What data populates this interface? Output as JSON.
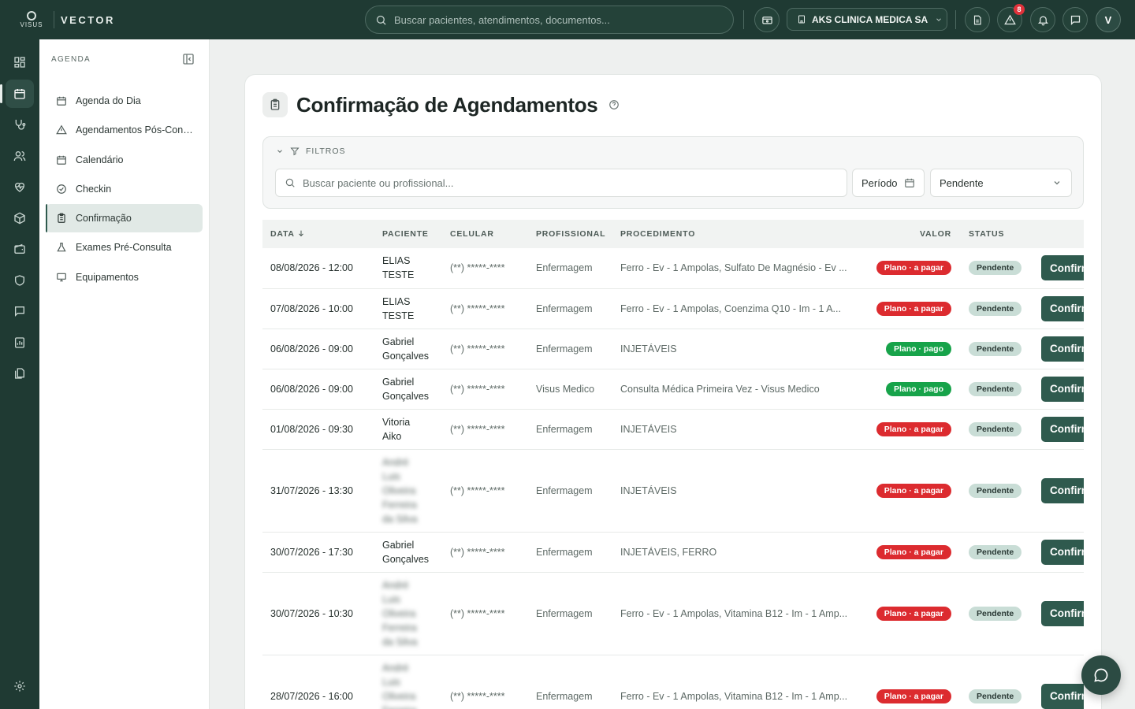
{
  "brand": {
    "logo_word": "VISUS",
    "name": "VECTOR"
  },
  "topbar": {
    "search_placeholder": "Buscar pacientes, atendimentos, documentos...",
    "clinic_name": "AKS CLINICA MEDICA SA",
    "alerts_count": "8",
    "avatar_initial": "V",
    "icons": [
      "wallet-icon",
      "building-icon",
      "document-icon",
      "alert-icon",
      "bell-icon",
      "chat-icon"
    ]
  },
  "rail": {
    "items": [
      "dashboard-icon",
      "calendar-icon",
      "stethoscope-icon",
      "users-icon",
      "heart-pulse-icon",
      "box-icon",
      "wallet-icon",
      "shield-icon",
      "message-icon",
      "report-icon",
      "files-icon"
    ],
    "active": "calendar-icon",
    "bottom": "settings-icon"
  },
  "sidebar": {
    "title": "AGENDA",
    "items": [
      {
        "label": "Agenda do Dia",
        "icon": "calendar-icon"
      },
      {
        "label": "Agendamentos Pós-Consulta",
        "icon": "warning-icon"
      },
      {
        "label": "Calendário",
        "icon": "calendar-icon"
      },
      {
        "label": "Checkin",
        "icon": "check-circle-icon"
      },
      {
        "label": "Confirmação",
        "icon": "clipboard-icon"
      },
      {
        "label": "Exames Pré-Consulta",
        "icon": "flask-icon"
      },
      {
        "label": "Equipamentos",
        "icon": "monitor-icon"
      }
    ],
    "active_index": 4
  },
  "page": {
    "title": "Confirmação de Agendamentos"
  },
  "filters": {
    "title": "FILTROS",
    "search_placeholder": "Buscar paciente ou profissional...",
    "period_label": "Período",
    "status_value": "Pendente"
  },
  "table": {
    "columns": [
      "DATA",
      "PACIENTE",
      "CELULAR",
      "PROFISSIONAL",
      "PROCEDIMENTO",
      "VALOR",
      "STATUS",
      ""
    ],
    "sort_column": "DATA",
    "action_label": "Confirmar",
    "rows": [
      {
        "data": "08/08/2026 - 12:00",
        "paciente": [
          "ELIAS",
          "TESTE"
        ],
        "celular": "(**) *****-****",
        "profissional": "Enfermagem",
        "procedimento": "Ferro - Ev - 1 Ampolas, Sulfato De Magnésio - Ev ...",
        "valor": "Plano · a pagar",
        "valor_color": "red",
        "status": "Pendente"
      },
      {
        "data": "07/08/2026 - 10:00",
        "paciente": [
          "ELIAS",
          "TESTE"
        ],
        "celular": "(**) *****-****",
        "profissional": "Enfermagem",
        "procedimento": "Ferro - Ev - 1 Ampolas, Coenzima Q10 - Im - 1 A...",
        "valor": "Plano · a pagar",
        "valor_color": "red",
        "status": "Pendente"
      },
      {
        "data": "06/08/2026 - 09:00",
        "paciente": [
          "Gabriel",
          "Gonçalves"
        ],
        "celular": "(**) *****-****",
        "profissional": "Enfermagem",
        "procedimento": "INJETÁVEIS",
        "valor": "Plano · pago",
        "valor_color": "green",
        "status": "Pendente"
      },
      {
        "data": "06/08/2026 - 09:00",
        "paciente": [
          "Gabriel",
          "Gonçalves"
        ],
        "celular": "(**) *****-****",
        "profissional": "Visus Medico",
        "procedimento": "Consulta Médica Primeira Vez - Visus Medico",
        "valor": "Plano · pago",
        "valor_color": "green",
        "status": "Pendente"
      },
      {
        "data": "01/08/2026 - 09:30",
        "paciente": [
          "Vitoria",
          "Aiko"
        ],
        "celular": "(**) *****-****",
        "profissional": "Enfermagem",
        "procedimento": "INJETÁVEIS",
        "valor": "Plano · a pagar",
        "valor_color": "red",
        "status": "Pendente"
      },
      {
        "data": "31/07/2026 - 13:30",
        "paciente": [
          "André",
          "Luis",
          "Oliveira",
          "Ferreira",
          "da Silva"
        ],
        "blurred": true,
        "celular": "(**) *****-****",
        "profissional": "Enfermagem",
        "procedimento": "INJETÁVEIS",
        "valor": "Plano · a pagar",
        "valor_color": "red",
        "status": "Pendente"
      },
      {
        "data": "30/07/2026 - 17:30",
        "paciente": [
          "Gabriel",
          "Gonçalves"
        ],
        "celular": "(**) *****-****",
        "profissional": "Enfermagem",
        "procedimento": "INJETÁVEIS, FERRO",
        "valor": "Plano · a pagar",
        "valor_color": "red",
        "status": "Pendente"
      },
      {
        "data": "30/07/2026 - 10:30",
        "paciente": [
          "André",
          "Luis",
          "Oliveira",
          "Ferreira",
          "da Silva"
        ],
        "blurred": true,
        "celular": "(**) *****-****",
        "profissional": "Enfermagem",
        "procedimento": "Ferro - Ev - 1 Ampolas, Vitamina B12 - Im - 1 Amp...",
        "valor": "Plano · a pagar",
        "valor_color": "red",
        "status": "Pendente"
      },
      {
        "data": "28/07/2026 - 16:00",
        "paciente": [
          "André",
          "Luis",
          "Oliveira",
          "Ferreira",
          "da Silva"
        ],
        "blurred": true,
        "celular": "(**) *****-****",
        "profissional": "Enfermagem",
        "procedimento": "Ferro - Ev - 1 Ampolas, Vitamina B12 - Im - 1 Amp...",
        "valor": "Plano · a pagar",
        "valor_color": "red",
        "status": "Pendente"
      }
    ]
  },
  "colors": {
    "primary": "#1f3a33",
    "accent": "#2f5a4e",
    "red_pill": "#dc2b2f",
    "green_pill": "#17a34a",
    "status_pill": "#c9ddd6"
  }
}
